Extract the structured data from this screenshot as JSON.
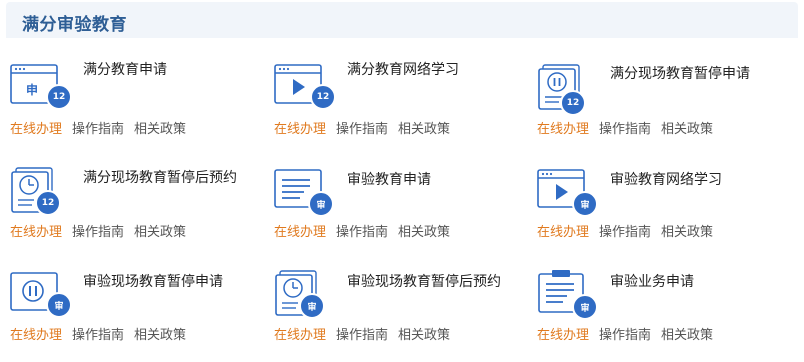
{
  "section": {
    "title": "满分审验教育"
  },
  "link_labels": {
    "online": "在线办理",
    "guide": "操作指南",
    "policy": "相关政策"
  },
  "services": [
    {
      "title": "满分教育申请",
      "icon": "application-window-icon",
      "badge": "12",
      "window_text": "申"
    },
    {
      "title": "满分教育网络学习",
      "icon": "video-play-window-icon",
      "badge": "12"
    },
    {
      "title": "满分现场教育暂停申请",
      "icon": "pause-document-icon",
      "badge": "12"
    },
    {
      "title": "满分现场教育暂停后预约",
      "icon": "clock-document-icon",
      "badge": "12"
    },
    {
      "title": "审验教育申请",
      "icon": "document-lines-icon",
      "badge": "审"
    },
    {
      "title": "审验教育网络学习",
      "icon": "video-play-window-icon",
      "badge": "审"
    },
    {
      "title": "审验现场教育暂停申请",
      "icon": "pause-window-icon",
      "badge": "审"
    },
    {
      "title": "审验现场教育暂停后预约",
      "icon": "clock-document-icon",
      "badge": "审"
    },
    {
      "title": "审验业务申请",
      "icon": "clipboard-icon",
      "badge": "审"
    }
  ],
  "colors": {
    "icon_stroke": "#2f6bc4",
    "badge": "#2f6bc4",
    "online_link": "#e07a1f",
    "header_bg": "#f1f5fa",
    "header_text": "#2e5e95"
  }
}
